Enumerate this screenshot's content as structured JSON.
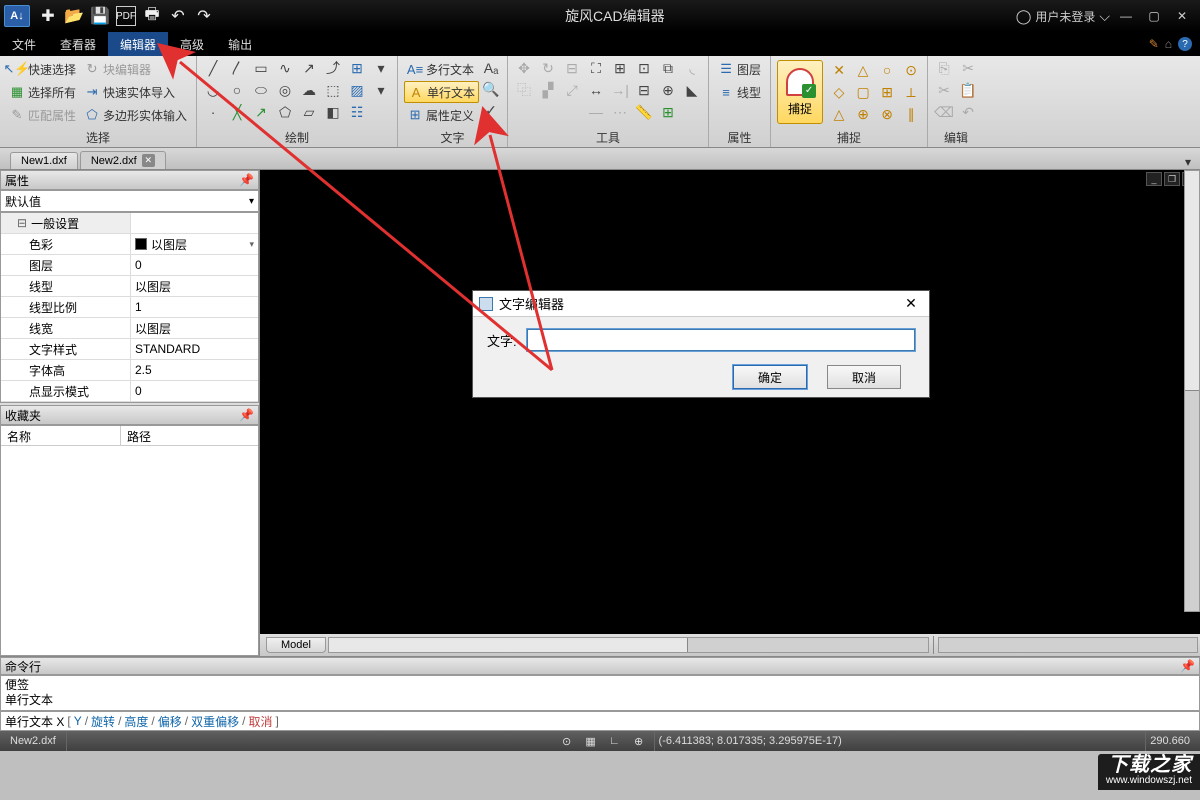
{
  "app": {
    "title": "旋风CAD编辑器"
  },
  "user": {
    "label": "用户未登录"
  },
  "menu": {
    "items": [
      "文件",
      "查看器",
      "编辑器",
      "高级",
      "输出"
    ],
    "active_index": 2
  },
  "ribbon": {
    "groups": {
      "select": {
        "label": "选择",
        "quick_select": "快速选择",
        "select_all": "选择所有",
        "match_props": "匹配属性",
        "block_editor": "块编辑器",
        "fast_entity_import": "快速实体导入",
        "poly_entity_input": "多边形实体输入"
      },
      "draw": {
        "label": "绘制"
      },
      "text": {
        "label": "文字",
        "mtext": "多行文本",
        "stext": "单行文本",
        "attdef": "属性定义"
      },
      "tools": {
        "label": "工具"
      },
      "props": {
        "label": "属性",
        "layer": "图层",
        "linetype": "线型"
      },
      "snap": {
        "label": "捕捉",
        "big": "捕捉"
      },
      "edit": {
        "label": "编辑"
      }
    }
  },
  "doctabs": {
    "tabs": [
      "New1.dxf",
      "New2.dxf"
    ],
    "active_index": 1
  },
  "properties": {
    "title": "属性",
    "selector": "默认值",
    "group": "一般设置",
    "rows": [
      {
        "label": "色彩",
        "value": "以图层",
        "swatch": true,
        "dropdown": true
      },
      {
        "label": "图层",
        "value": "0"
      },
      {
        "label": "线型",
        "value": "以图层"
      },
      {
        "label": "线型比例",
        "value": "1"
      },
      {
        "label": "线宽",
        "value": "以图层"
      },
      {
        "label": "文字样式",
        "value": "STANDARD"
      },
      {
        "label": "字体高",
        "value": "2.5"
      },
      {
        "label": "点显示模式",
        "value": "0"
      }
    ]
  },
  "favorites": {
    "title": "收藏夹",
    "col_name": "名称",
    "col_path": "路径"
  },
  "modeltab": "Model",
  "commandline": {
    "title": "命令行",
    "history": [
      "便签",
      "单行文本"
    ],
    "prompt_main": "单行文本 X",
    "opts": [
      "Y",
      "旋转",
      "高度",
      "偏移",
      "双重偏移"
    ],
    "cancel": "取消"
  },
  "dialog": {
    "title": "文字编辑器",
    "field_label": "文字:",
    "value": "",
    "ok": "确定",
    "cancel": "取消"
  },
  "status": {
    "file": "New2.dxf",
    "coords": "(-6.411383; 8.017335; 3.295975E-17)",
    "zoom": "290.660"
  },
  "watermark": {
    "big": "下载之家",
    "small": "www.windowszj.net"
  }
}
